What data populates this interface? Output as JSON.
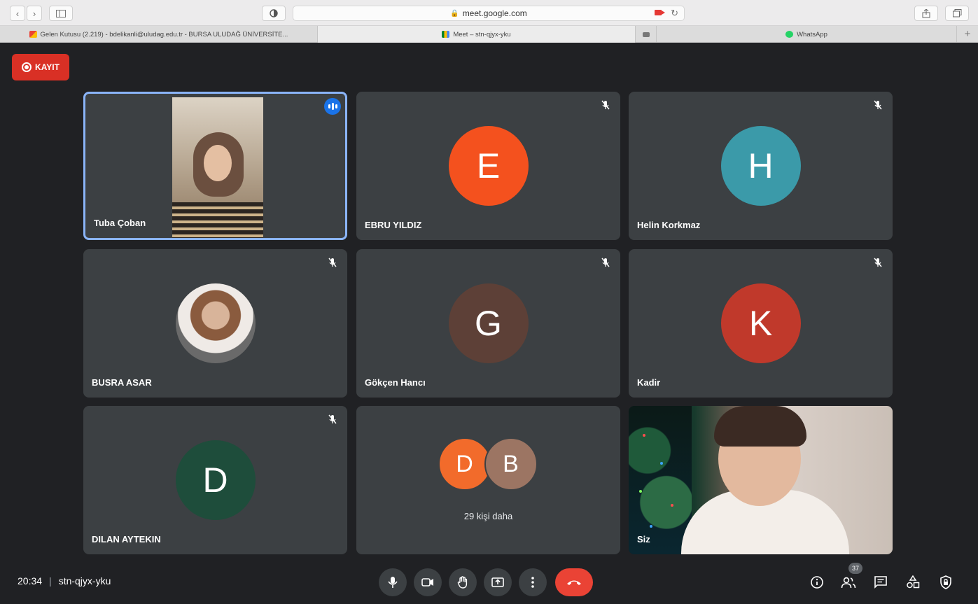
{
  "browser": {
    "url": "meet.google.com",
    "tabs": [
      {
        "title": "Gelen Kutusu (2.219) - bdelikanli@uludag.edu.tr - BURSA ULUDAĞ ÜNİVERSİTE...",
        "icon": "gmail-icon"
      },
      {
        "title": "Meet – stn-qjyx-yku",
        "icon": "meet-icon"
      },
      {
        "title": "",
        "icon": "video-icon"
      },
      {
        "title": "WhatsApp",
        "icon": "whatsapp-icon"
      }
    ]
  },
  "recording": {
    "label": "KAYIT",
    "color": "#d93025"
  },
  "participants": [
    {
      "name": "Tuba Çoban",
      "type": "video",
      "speaking": true
    },
    {
      "name": "EBRU YILDIZ",
      "initial": "E",
      "color": "#f4511e",
      "muted": true
    },
    {
      "name": "Helin Korkmaz",
      "initial": "H",
      "color": "#3b9aa9",
      "muted": true
    },
    {
      "name": "BUSRA ASAR",
      "type": "photo",
      "muted": true
    },
    {
      "name": "Gökçen Hancı",
      "initial": "G",
      "color": "#5d4037",
      "muted": true
    },
    {
      "name": "Kadir",
      "initial": "K",
      "color": "#c0392b",
      "muted": true
    },
    {
      "name": "DILAN AYTEKIN",
      "initial": "D",
      "color": "#1e4d3b",
      "muted": true
    }
  ],
  "others": {
    "initials": [
      "D",
      "B"
    ],
    "colors": [
      "#f26b2b",
      "#9c7563"
    ],
    "label": "29 kişi daha"
  },
  "self": {
    "name": "Siz"
  },
  "bottom": {
    "time": "20:34",
    "separator": "|",
    "meeting_code": "stn-qjyx-yku",
    "participant_count": "37"
  }
}
